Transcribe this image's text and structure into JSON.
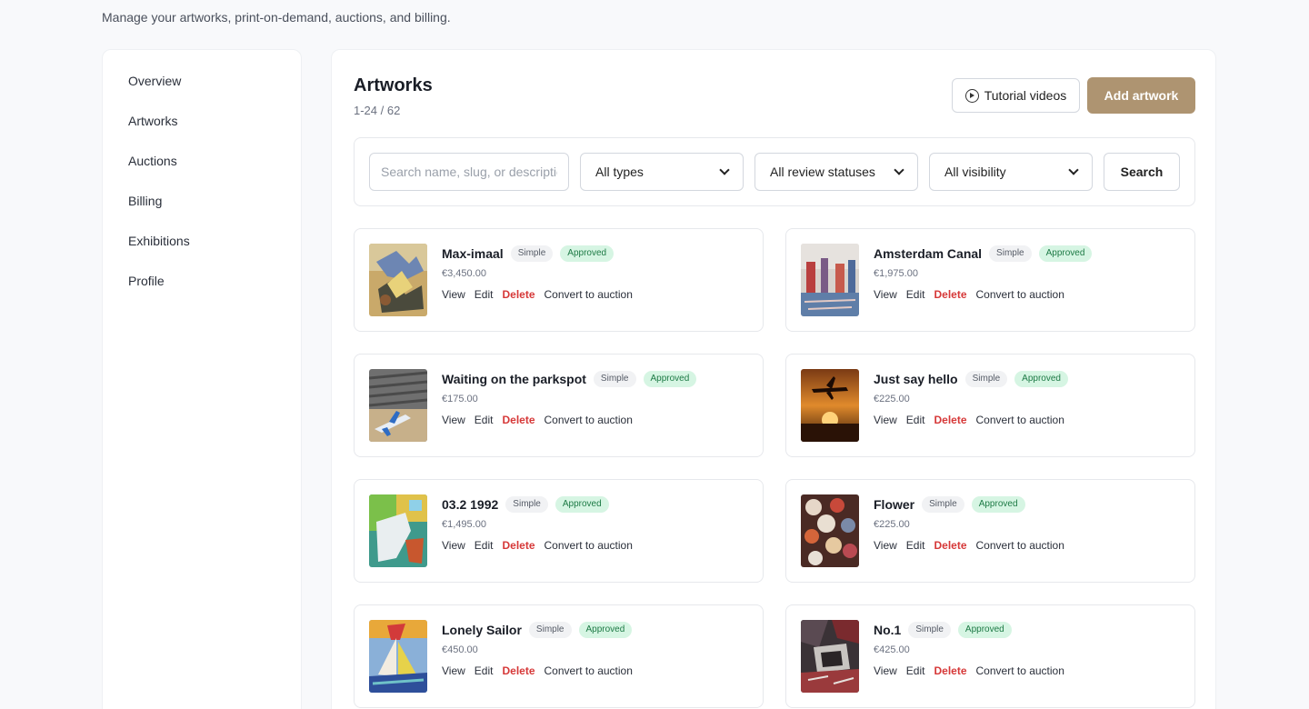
{
  "page": {
    "subtitle": "Manage your artworks, print-on-demand, auctions, and billing."
  },
  "sidebar": {
    "items": [
      {
        "label": "Overview"
      },
      {
        "label": "Artworks"
      },
      {
        "label": "Auctions"
      },
      {
        "label": "Billing"
      },
      {
        "label": "Exhibitions"
      },
      {
        "label": "Profile"
      }
    ]
  },
  "main": {
    "title": "Artworks",
    "count": "1-24 / 62",
    "tutorial_label": "Tutorial videos",
    "add_label": "Add artwork",
    "search_placeholder": "Search name, slug, or description",
    "filters": {
      "type": "All types",
      "review": "All review statuses",
      "visibility": "All visibility"
    },
    "search_button": "Search"
  },
  "actions": {
    "view": "View",
    "edit": "Edit",
    "delete": "Delete",
    "convert": "Convert to auction"
  },
  "artworks": [
    {
      "title": "Max-imaal",
      "type": "Simple",
      "status": "Approved",
      "price": "€3,450.00"
    },
    {
      "title": "Amsterdam Canal",
      "type": "Simple",
      "status": "Approved",
      "price": "€1,975.00"
    },
    {
      "title": "Waiting on the parkspot",
      "type": "Simple",
      "status": "Approved",
      "price": "€175.00"
    },
    {
      "title": "Just say hello",
      "type": "Simple",
      "status": "Approved",
      "price": "€225.00"
    },
    {
      "title": "03.2 1992",
      "type": "Simple",
      "status": "Approved",
      "price": "€1,495.00"
    },
    {
      "title": "Flower",
      "type": "Simple",
      "status": "Approved",
      "price": "€225.00"
    },
    {
      "title": "Lonely Sailor",
      "type": "Simple",
      "status": "Approved",
      "price": "€450.00"
    },
    {
      "title": "No.1",
      "type": "Simple",
      "status": "Approved",
      "price": "€425.00"
    }
  ],
  "colors": {
    "accent": "#ae9471",
    "delete": "#d63838",
    "approved_bg": "#d6f5e3",
    "approved_text": "#1d7a45"
  }
}
